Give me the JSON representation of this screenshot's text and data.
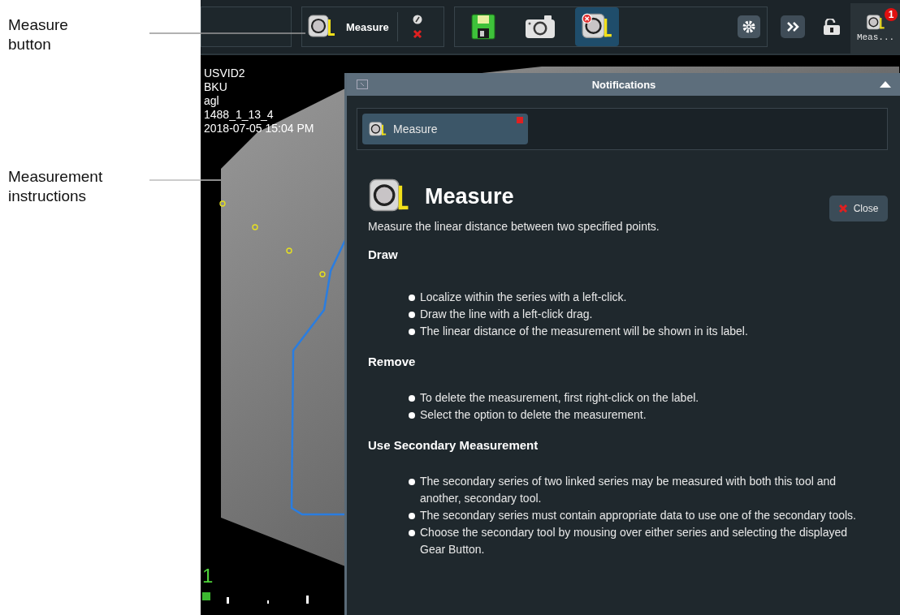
{
  "annotations": [
    {
      "label": "Measure button"
    },
    {
      "label": "Measurement instructions"
    }
  ],
  "toolbar": {
    "tool": {
      "label": "Measure"
    },
    "actions": [
      {
        "kind": "save",
        "selected": false
      },
      {
        "kind": "camera",
        "selected": false
      },
      {
        "kind": "measure",
        "selected": true
      }
    ],
    "notification_button": {
      "label": "Meas...",
      "badge": "1"
    }
  },
  "viewer": {
    "overlay_lines": [
      "USVID2",
      "BKU",
      "agl",
      "1488_1_13_4",
      "2018-07-05 15:04 PM"
    ],
    "frame_number": "1"
  },
  "notifications": {
    "title": "Notifications",
    "tabs": [
      {
        "label": "Measure",
        "selected": true
      }
    ],
    "heading": "Measure",
    "close_label": "Close",
    "description": "Measure the linear distance between two specified points.",
    "sections": [
      {
        "title": "Draw",
        "items": [
          "Localize within the series with a left-click.",
          "Draw the line with a left-click drag.",
          "The linear distance of the measurement will be shown in its label."
        ]
      },
      {
        "title": "Remove",
        "items": [
          "To delete the measurement, first right-click on the label.",
          "Select the option to delete the measurement."
        ]
      },
      {
        "title": "Use Secondary Measurement",
        "items": [
          "The secondary series of two linked series may be measured with both this tool and another, secondary tool.",
          "The secondary series must contain appropriate data to use one of the secondary tools.",
          "Choose the secondary tool by mousing over either series and selecting the displayed Gear Button."
        ]
      }
    ]
  }
}
